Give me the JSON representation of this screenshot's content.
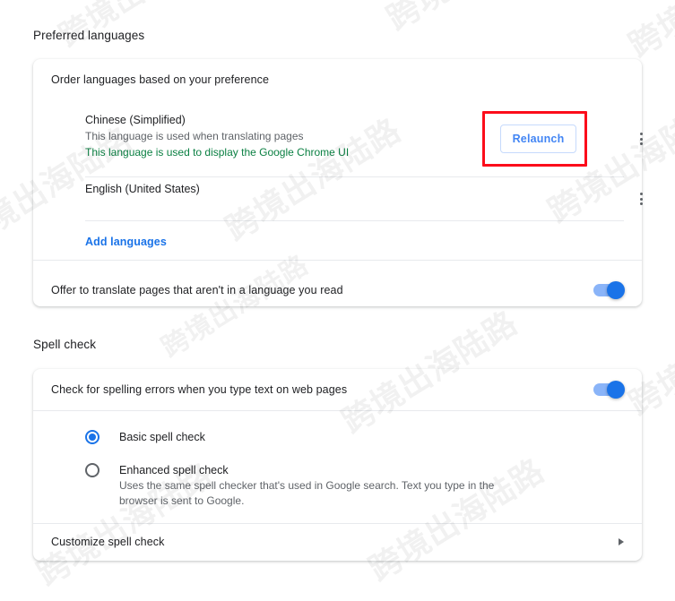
{
  "watermark": {
    "text": "跨境出海陆路",
    "color": "#000000"
  },
  "languages_section": {
    "title": "Preferred languages",
    "card_label": "Order languages based on your preference",
    "items": [
      {
        "name": "Chinese (Simplified)",
        "sub1": "This language is used when translating pages",
        "sub2": "This language is used to display the Google Chrome UI",
        "has_relaunch": true
      },
      {
        "name": "English (United States)",
        "sub1": "",
        "sub2": "",
        "has_relaunch": false
      }
    ],
    "relaunch_label": "Relaunch",
    "add_languages_label": "Add languages",
    "translate_pref": {
      "label": "Offer to translate pages that aren't in a language you read",
      "enabled": true
    },
    "menu_icon": "more-vert-icon",
    "annotation_color": "#fc0d1b",
    "accent_color": "#1a73e8",
    "ui_language_color": "#0b8043"
  },
  "spellcheck_section": {
    "title": "Spell check",
    "toggle_row": {
      "label": "Check for spelling errors when you type text on web pages",
      "enabled": true
    },
    "options": [
      {
        "label": "Basic spell check",
        "description": "",
        "selected": true
      },
      {
        "label": "Enhanced spell check",
        "description": "Uses the same spell checker that's used in Google search. Text you type in the browser is sent to Google.",
        "selected": false
      }
    ],
    "customize": {
      "label": "Customize spell check",
      "chevron_icon": "chevron-right-icon"
    }
  }
}
